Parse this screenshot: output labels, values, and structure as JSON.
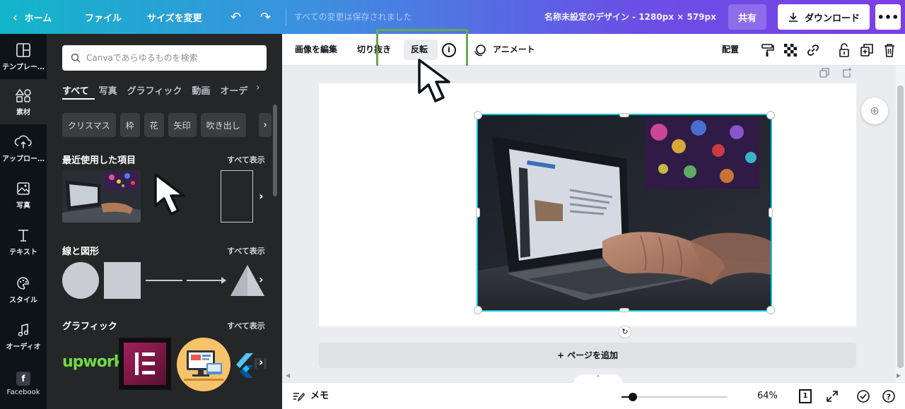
{
  "topbar": {
    "home_label": "ホーム",
    "file_label": "ファイル",
    "resize_label": "サイズを変更",
    "saved_status": "すべての変更は保存されました",
    "design_title": "名称未設定のデザイン - 1280px × 579px",
    "share_label": "共有",
    "download_label": "ダウンロード"
  },
  "rail": {
    "items": [
      {
        "label": "テンプレー…",
        "icon": "template-icon"
      },
      {
        "label": "素材",
        "icon": "elements-icon"
      },
      {
        "label": "アップロー…",
        "icon": "upload-icon"
      },
      {
        "label": "写真",
        "icon": "photo-icon"
      },
      {
        "label": "テキスト",
        "icon": "text-icon"
      },
      {
        "label": "スタイル",
        "icon": "palette-icon"
      },
      {
        "label": "オーディオ",
        "icon": "audio-icon"
      },
      {
        "label": "Facebook",
        "icon": "facebook-icon"
      }
    ]
  },
  "panel": {
    "search_placeholder": "Canvaであらゆるものを検索",
    "tabs": [
      "すべて",
      "写真",
      "グラフィック",
      "動画",
      "オーデ"
    ],
    "chips": [
      "クリスマス",
      "枠",
      "花",
      "矢印",
      "吹き出し"
    ],
    "recent_title": "最近使用した項目",
    "lines_title": "線と図形",
    "graphics_title": "グラフィック",
    "see_all": "すべて表示",
    "upwork_text": "upwork",
    "flutter_text": "Fl"
  },
  "context_toolbar": {
    "edit_image": "画像を編集",
    "crop": "切り抜き",
    "flip": "反転",
    "animate": "アニメート",
    "position": "配置"
  },
  "canvas": {
    "add_page": "+ ページを追加"
  },
  "bottombar": {
    "memo": "メモ",
    "zoom": "64%",
    "page_number": "1"
  },
  "colors": {
    "accent_selection": "#13c1d8",
    "highlight_box": "#6aa84f",
    "dark_panel": "#252627",
    "rail_bg": "#0e1318"
  }
}
